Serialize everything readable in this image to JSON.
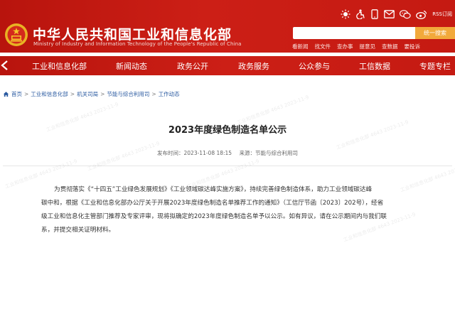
{
  "header": {
    "title_cn": "中华人民共和国工业和信息化部",
    "title_en": "Ministry of Industry and Information Technology of the People's Republic of China",
    "rss_label": "RSS订阅",
    "search": {
      "placeholder": "",
      "button_label": "统一搜索"
    },
    "quick_links": [
      "看新闻",
      "找文件",
      "查办事",
      "提意见",
      "查数据",
      "要投诉"
    ]
  },
  "nav": {
    "items": [
      "工业和信息化部",
      "新闻动态",
      "政务公开",
      "政务服务",
      "公众参与",
      "工信数据",
      "专题专栏"
    ]
  },
  "breadcrumb": [
    "首页",
    "工业和信息化部",
    "机关司局",
    "节能与综合利用司",
    "工作动态"
  ],
  "article": {
    "title": "2023年度绿色制造名单公示",
    "publish_time": "发布时间：2023-11-08 18:15",
    "source": "来源：节能与综合利用司",
    "body_lines": [
      "为贯彻落实《“十四五”工业绿色发展规划》《工业领域碳达峰实施方案》，持续完善绿色制造体系，助力工业领域碳达峰",
      "碳中和，根据《工业和信息化部办公厅关于开展2023年度绿色制造名单推荐工作的通知》（工信厅节函〔2023〕202号），经省",
      "级工业和信息化主管部门推荐及专家评审，现将拟确定的2023年度绿色制造名单予以公示。如有异议，请在公示期间内与我们联",
      "系，并提交相关证明材料。"
    ]
  },
  "watermark": "工业和信息化部 4643\n2023-11-9",
  "colors": {
    "brand_red": "#c81a12",
    "search_button": "#f2a93b",
    "link_blue": "#2a5aa0"
  }
}
